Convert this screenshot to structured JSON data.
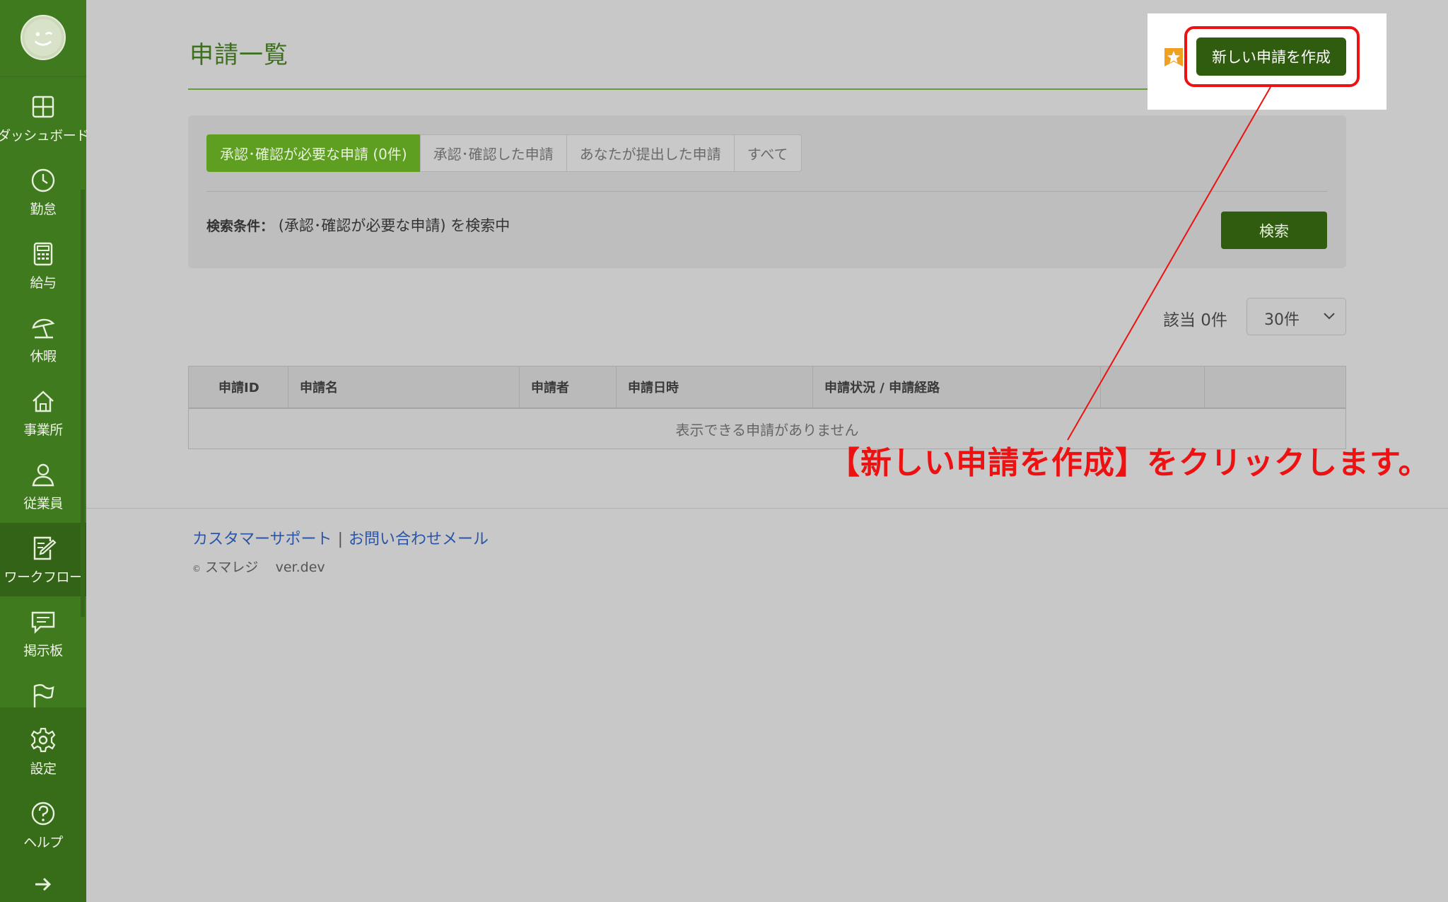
{
  "sidebar": {
    "items": [
      {
        "label": "ダッシュボード",
        "icon": "dashboard-icon"
      },
      {
        "label": "勤怠",
        "icon": "clock-icon"
      },
      {
        "label": "給与",
        "icon": "calculator-icon"
      },
      {
        "label": "休暇",
        "icon": "beach-umbrella-icon"
      },
      {
        "label": "事業所",
        "icon": "home-icon"
      },
      {
        "label": "従業員",
        "icon": "person-icon"
      },
      {
        "label": "ワークフロー",
        "icon": "workflow-icon",
        "active": true
      },
      {
        "label": "掲示板",
        "icon": "message-board-icon"
      },
      {
        "label": "",
        "icon": "flag-icon"
      },
      {
        "label": "設定",
        "icon": "gear-icon"
      },
      {
        "label": "ヘルプ",
        "icon": "help-icon"
      }
    ]
  },
  "header": {
    "title": "申請一覧",
    "create_button": "新しい申請を作成"
  },
  "tabs": [
    {
      "label": "承認･確認が必要な申請 (0件)",
      "active": true
    },
    {
      "label": "承認･確認した申請"
    },
    {
      "label": "あなたが提出した申請"
    },
    {
      "label": "すべて"
    }
  ],
  "search": {
    "condition_label": "検索条件：",
    "condition_value": "(承認･確認が必要な申請) を検索中",
    "button": "検索"
  },
  "results": {
    "count_label": "該当 0件",
    "per_page": "30件"
  },
  "table": {
    "columns": [
      "申請ID",
      "申請名",
      "申請者",
      "申請日時",
      "申請状況 / 申請経路",
      "",
      ""
    ],
    "empty_message": "表示できる申請がありません"
  },
  "footer": {
    "link_support": "カスタマーサポート",
    "separator": "|",
    "link_mail": "お問い合わせメール",
    "copyright_symbol": "©",
    "brand": "スマレジ",
    "version": "ver.dev"
  },
  "annotation": {
    "text": "【新しい申請を作成】をクリックします。",
    "color": "#ee1111"
  },
  "colors": {
    "sidebar": "#3f7a1f",
    "accent_button": "#2f5c0f",
    "active_tab": "#5e9e20",
    "title": "#3d6f1f"
  }
}
